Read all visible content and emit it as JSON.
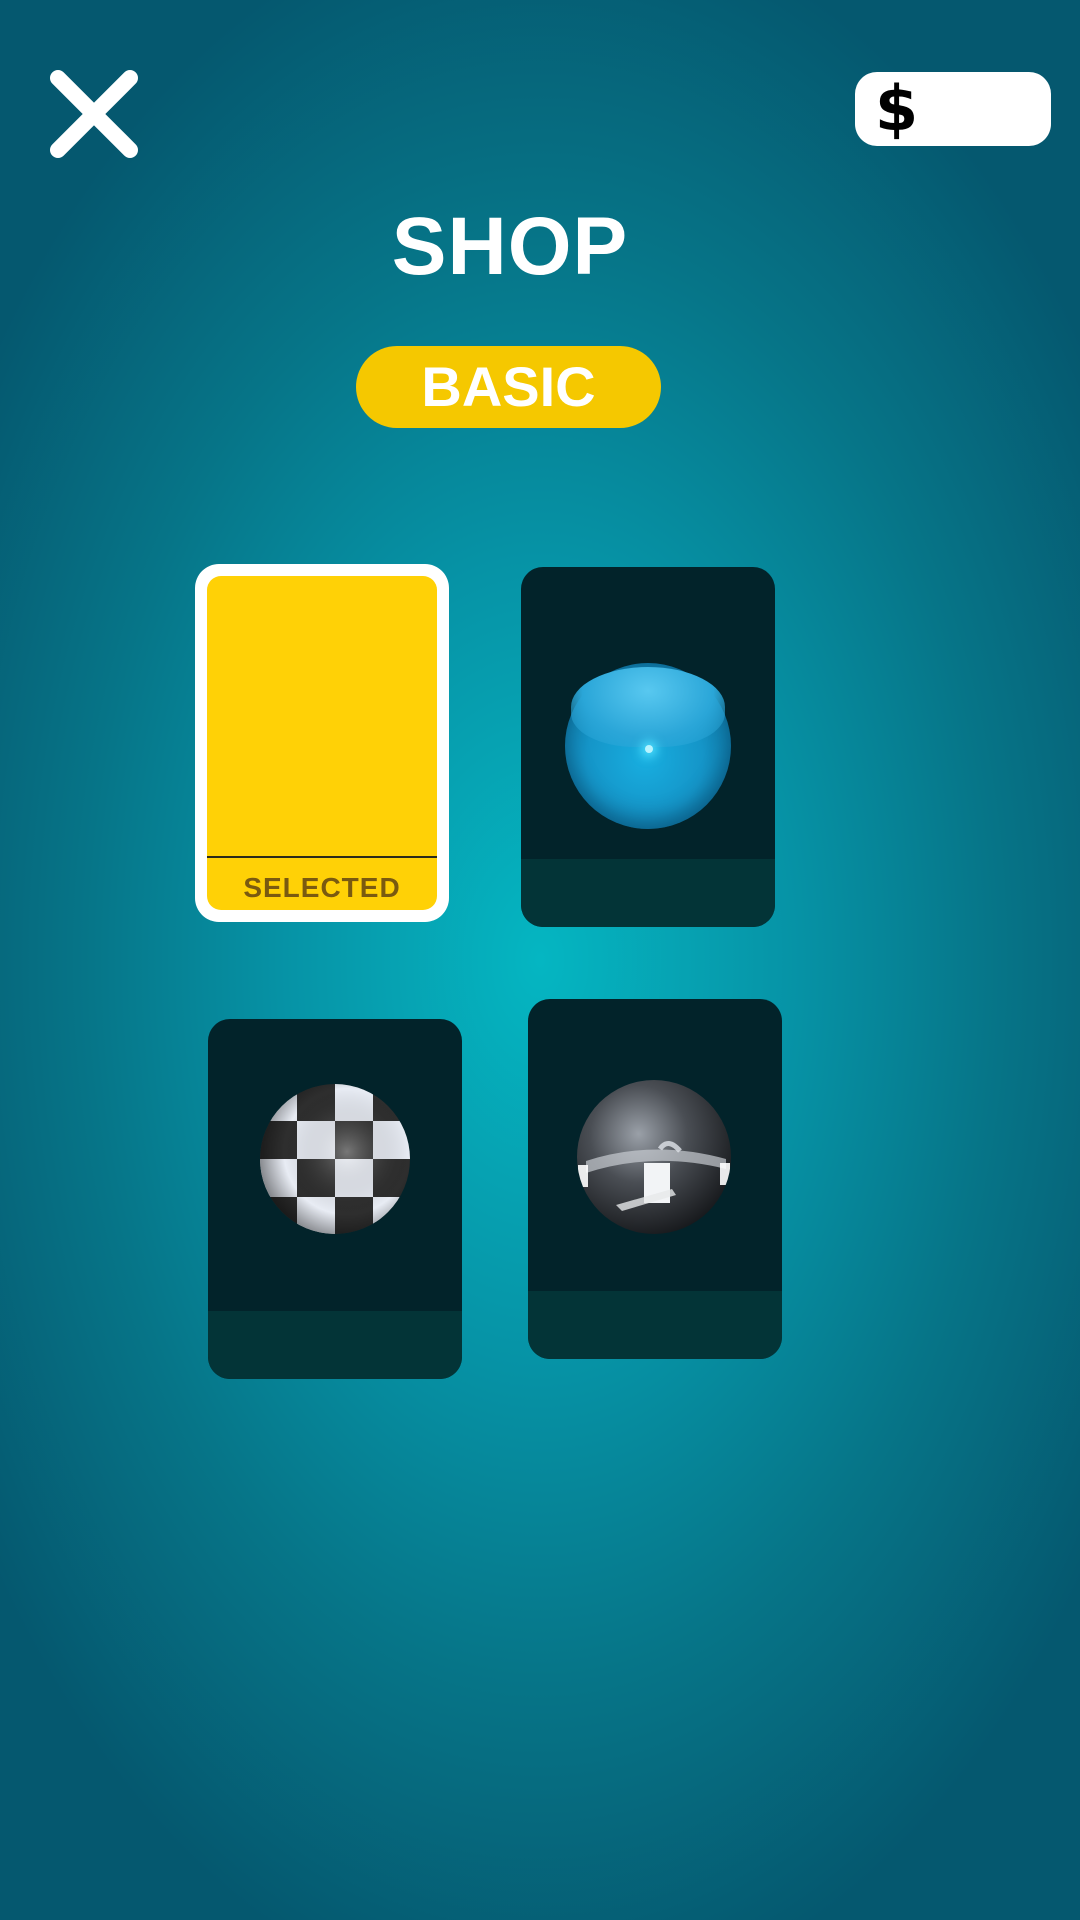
{
  "header": {
    "close_icon": "close-icon",
    "currency_symbol": "$",
    "currency_amount": "",
    "title": "SHOP"
  },
  "category_tab": {
    "label": "BASIC",
    "color": "#f5c800"
  },
  "items": [
    {
      "name": "Yellow",
      "state": "SELECTED",
      "color": "#ffd106"
    },
    {
      "name": "Glossy blue sphere",
      "state": ""
    },
    {
      "name": "Checkered sphere",
      "state": ""
    },
    {
      "name": "Chrome reflective sphere",
      "state": ""
    }
  ],
  "colors": {
    "background": "#0693a6",
    "card": "#02232a",
    "card_footer": "#033437",
    "selected_border": "#ffffff"
  }
}
